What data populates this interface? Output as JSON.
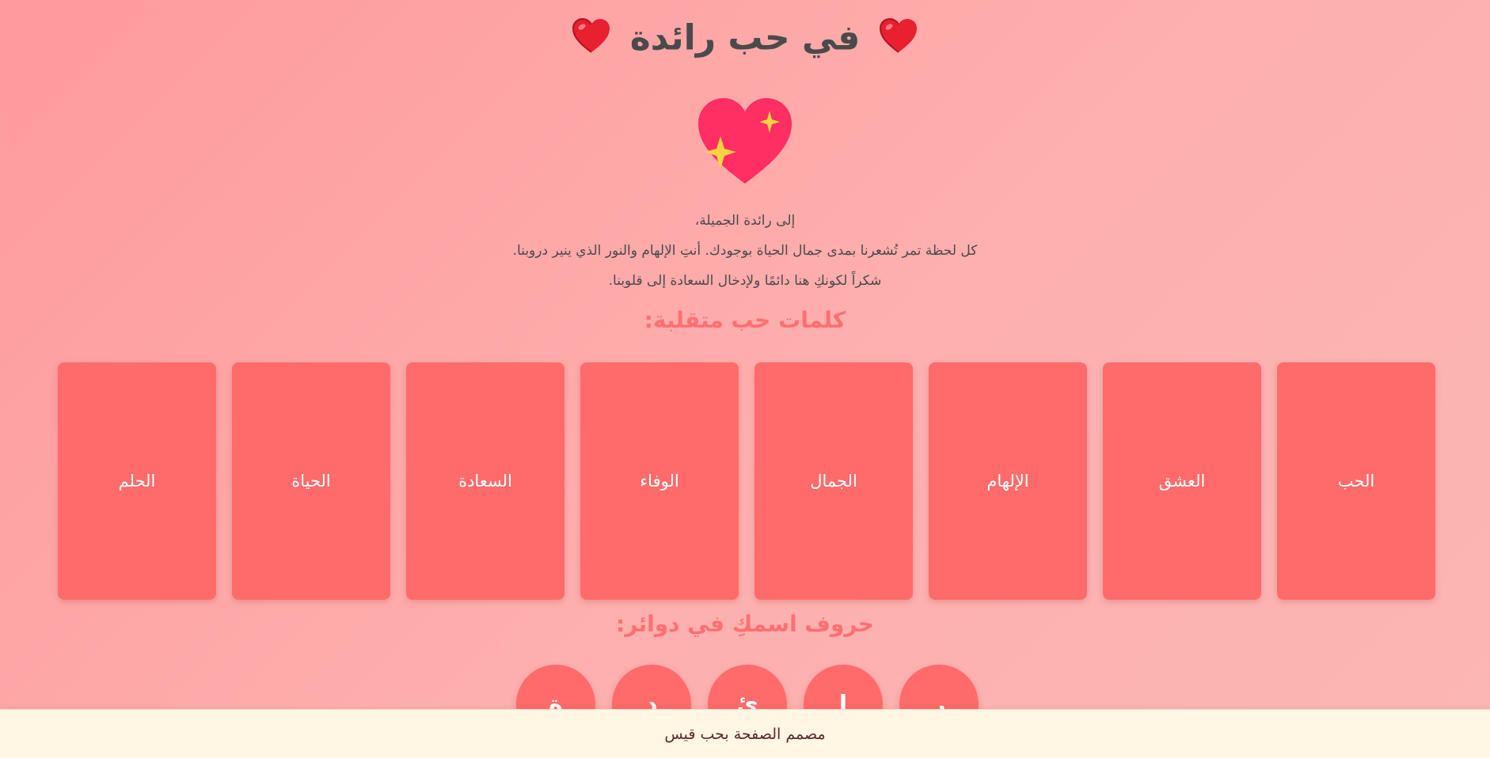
{
  "header": {
    "title": "في حب رائدة"
  },
  "message": {
    "line1": "إلى رائدة الجميلة،",
    "line2": "كل لحظة تمر تُشعرنا بمدى جمال الحياة بوجودك. أنتِ الإلهام والنور الذي ينير دروبنا.",
    "line3": "شكراً لكونكِ هنا دائمًا ولإدخال السعادة إلى قلوبنا."
  },
  "flip_section": {
    "title": "كلمات حب متقلبة:",
    "cards": [
      {
        "label": "الحب"
      },
      {
        "label": "العشق"
      },
      {
        "label": "الإلهام"
      },
      {
        "label": "الجمال"
      },
      {
        "label": "الوفاء"
      },
      {
        "label": "السعادة"
      },
      {
        "label": "الحياة"
      },
      {
        "label": "الحلم"
      }
    ]
  },
  "letters_section": {
    "title": "حروف اسمكِ في دوائر:",
    "letters": [
      "ر",
      "ا",
      "ئ",
      "د",
      "ة"
    ]
  },
  "footer": {
    "text": "مصمم الصفحة بحب قيس"
  },
  "icons": {
    "title_hearts": "red-heart-icon",
    "main_heart": "sparkling-heart-icon"
  },
  "colors": {
    "card": "#ff6b6b",
    "section_title": "#ff6f73",
    "footer_bg": "#fff6e3"
  }
}
